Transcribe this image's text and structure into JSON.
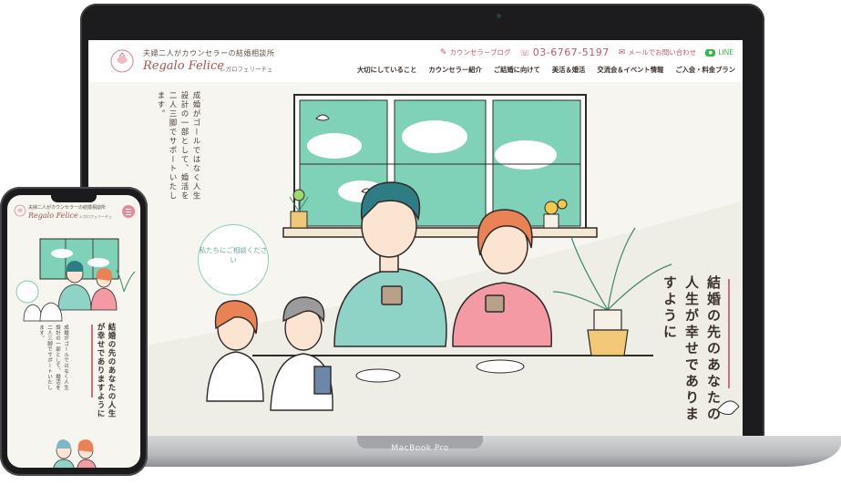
{
  "desktop": {
    "header": {
      "tagline": "夫婦二人がカウンセラーの結婚相談所",
      "brand": "Regalo Felice",
      "brand_kana": "レガロフェリーチェ",
      "blog_link": "カウンセラーブログ",
      "phone": "03-6767-5197",
      "mail_link": "メールでお問い合わせ",
      "line_link": "LINE",
      "nav": [
        "大切にしていること",
        "カウンセラー紹介",
        "ご結婚に向けて",
        "美活＆婚活",
        "交流会＆イベント情報",
        "ご入会・料金プラン"
      ]
    },
    "hero": {
      "intro": "成婚がゴールではなく人生設計の一部として、婚活を二人三脚でサポートいたします。",
      "bubble": "私たちにご相談ください",
      "catch": "結婚の先のあなたの人生が幸せでありますように"
    }
  },
  "mobile": {
    "tagline": "夫婦二人がカウンセラーの結婚相談所",
    "brand": "Regalo Felice",
    "brand_kana": "レガロフェリーチェ",
    "catch": "結婚の先のあなたの人生が幸せでありますように",
    "intro": "成婚がゴールではなく人生設計の一部として、婚活を二人三脚でサポートいたします。"
  },
  "device_label": "MacBook Pro",
  "colors": {
    "accent": "#c2576b",
    "brand": "#a4544f",
    "window_frame": "#5fc1a6",
    "line": "#35b54a"
  }
}
